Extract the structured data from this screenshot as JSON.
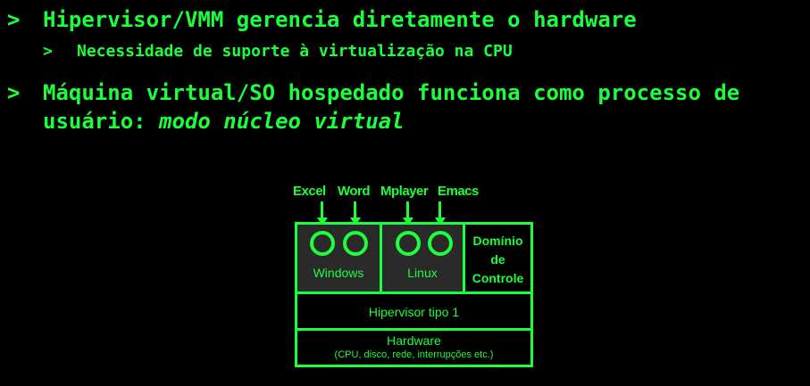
{
  "bullets": {
    "marker": ">",
    "item1": "Hipervisor/VMM gerencia diretamente o hardware",
    "item1_sub1": "Necessidade de suporte à virtualização na CPU",
    "item2_line1": "Máquina virtual/SO hospedado funciona como processo de",
    "item2_line2_prefix": "usuário: ",
    "item2_line2_emph": "modo núcleo virtual"
  },
  "diagram": {
    "apps": [
      "Excel",
      "Word",
      "Mplayer",
      "Emacs"
    ],
    "vm1_label": "Windows",
    "vm2_label": "Linux",
    "control_domain": [
      "Domínio",
      "de",
      "Controle"
    ],
    "hypervisor_label": "Hipervisor tipo 1",
    "hardware_title": "Hardware",
    "hardware_detail": "(CPU, disco, rede, interrupções etc.)"
  },
  "colors": {
    "text": "#1dff3c",
    "background": "#000000",
    "vm_fill": "#2a2a2a"
  }
}
